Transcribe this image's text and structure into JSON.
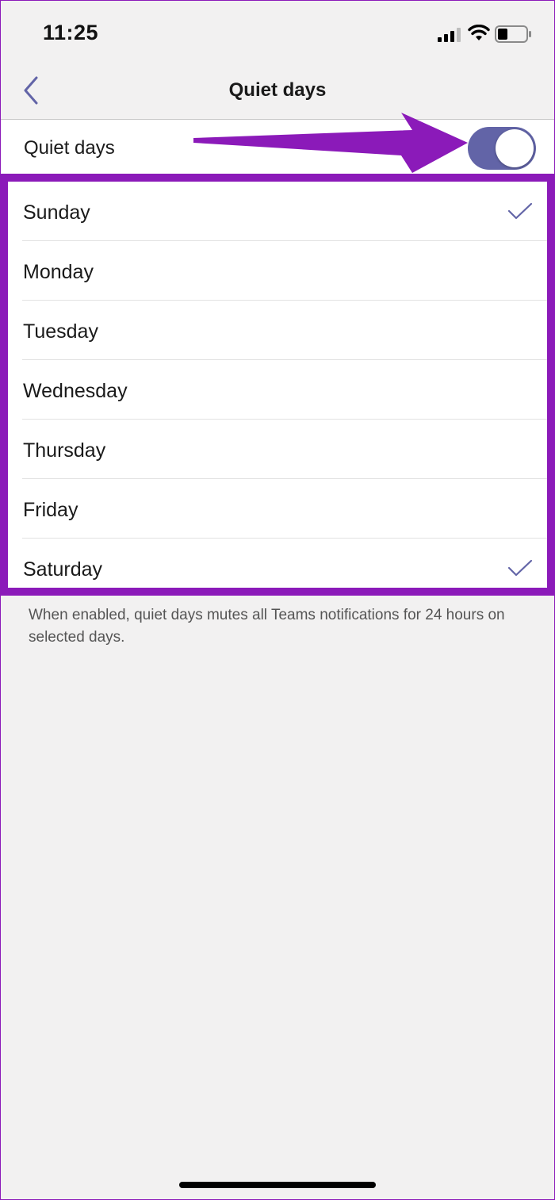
{
  "status_bar": {
    "time": "11:25",
    "icons": [
      "signal-icon",
      "wifi-icon",
      "battery-icon"
    ]
  },
  "nav": {
    "back_icon": "chevron-left-icon",
    "title": "Quiet days"
  },
  "toggle_row": {
    "label": "Quiet days",
    "enabled": true
  },
  "days": [
    {
      "label": "Sunday",
      "selected": true
    },
    {
      "label": "Monday",
      "selected": false
    },
    {
      "label": "Tuesday",
      "selected": false
    },
    {
      "label": "Wednesday",
      "selected": false
    },
    {
      "label": "Thursday",
      "selected": false
    },
    {
      "label": "Friday",
      "selected": false
    },
    {
      "label": "Saturday",
      "selected": true
    }
  ],
  "footnote": "When enabled, quiet days mutes all Teams notifications for 24 hours on selected days.",
  "colors": {
    "accent": "#6264a7",
    "annotation": "#8b1ab9",
    "background": "#f2f1f1"
  }
}
